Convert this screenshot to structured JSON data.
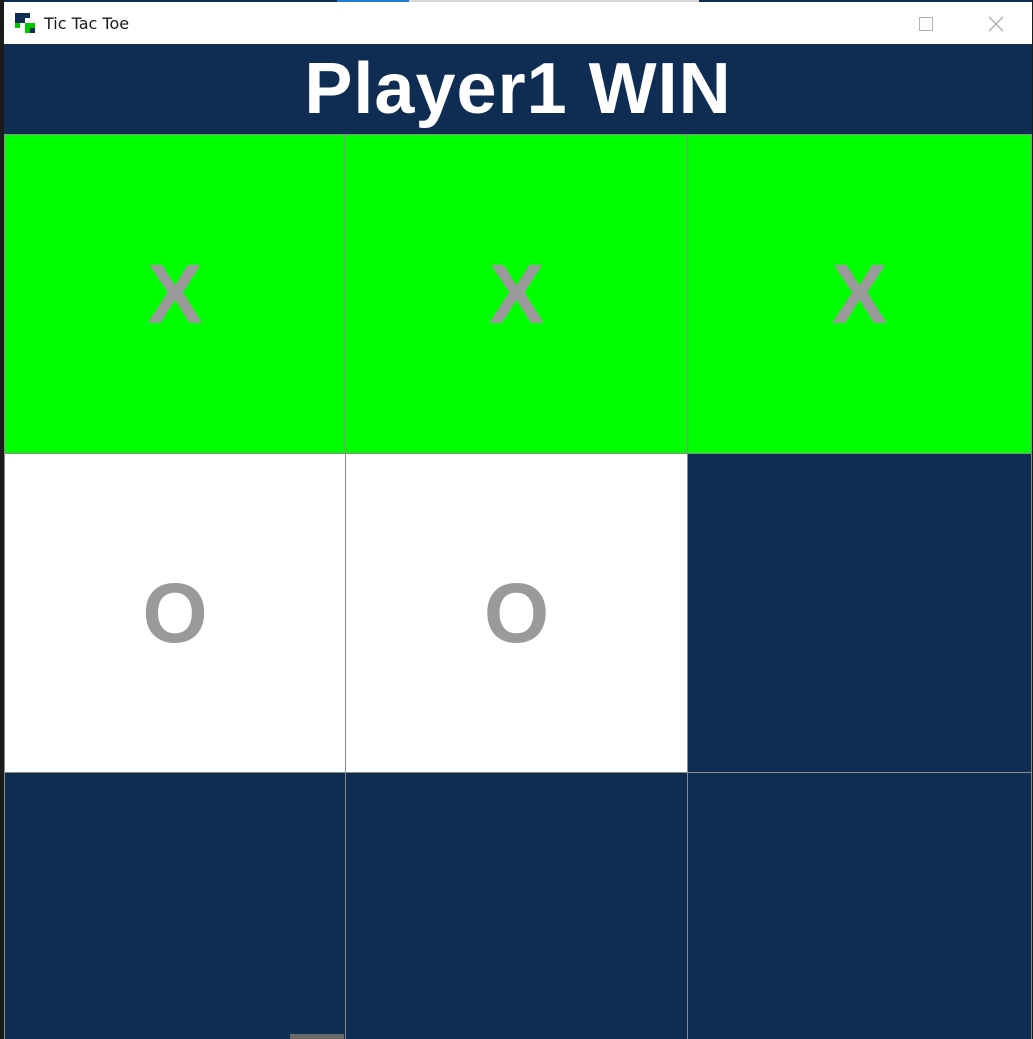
{
  "window": {
    "title": "Tic Tac Toe",
    "icon": "app-grid-icon"
  },
  "header": {
    "status": "Player1 WIN"
  },
  "colors": {
    "background": "#0f2d52",
    "win_highlight": "#00ff00",
    "played_cell": "#ffffff",
    "mark": "#9a9a9a"
  },
  "board": {
    "cells": [
      {
        "mark": "X",
        "state": "win"
      },
      {
        "mark": "X",
        "state": "win"
      },
      {
        "mark": "X",
        "state": "win"
      },
      {
        "mark": "O",
        "state": "played"
      },
      {
        "mark": "O",
        "state": "played"
      },
      {
        "mark": "",
        "state": "empty"
      },
      {
        "mark": "",
        "state": "empty"
      },
      {
        "mark": "",
        "state": "empty"
      },
      {
        "mark": "",
        "state": "empty"
      }
    ]
  }
}
